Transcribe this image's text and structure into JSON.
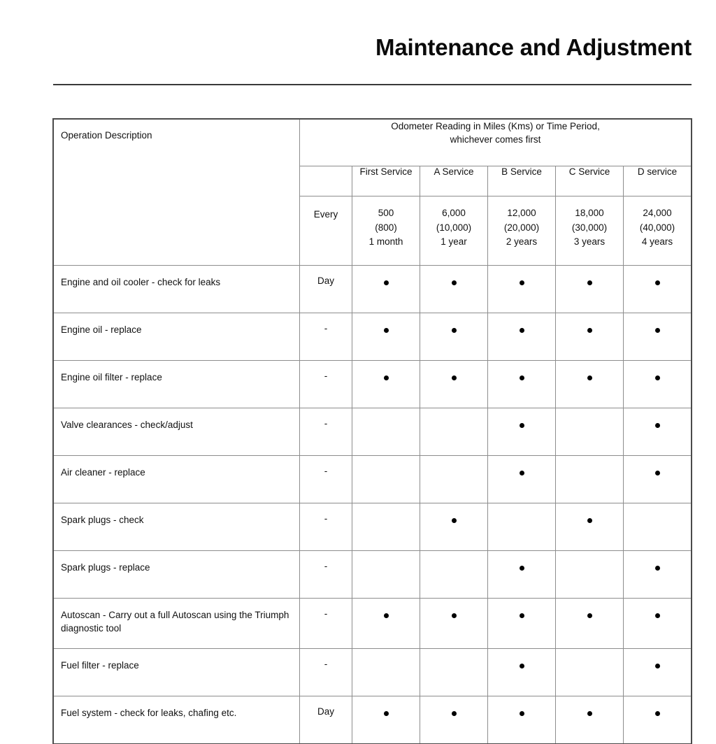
{
  "page": {
    "title": "Maintenance and Adjustment"
  },
  "table": {
    "desc_header": "Operation Description",
    "odometer_header_line1": "Odometer Reading in Miles (Kms) or Time Period,",
    "odometer_header_line2": "whichever comes first",
    "every_label": "Every",
    "service_columns": [
      {
        "name": "First Service",
        "miles": "500",
        "kms": "(800)",
        "time": "1 month"
      },
      {
        "name": "A Service",
        "miles": "6,000",
        "kms": "(10,000)",
        "time": "1 year"
      },
      {
        "name": "B Service",
        "miles": "12,000",
        "kms": "(20,000)",
        "time": "2 years"
      },
      {
        "name": "C Service",
        "miles": "18,000",
        "kms": "(30,000)",
        "time": "3 years"
      },
      {
        "name": "D service",
        "miles": "24,000",
        "kms": "(40,000)",
        "time": "4 years"
      }
    ],
    "rows": [
      {
        "description": "Engine and oil cooler - check for leaks",
        "every": "Day",
        "marks": [
          "●",
          "●",
          "●",
          "●",
          "●"
        ]
      },
      {
        "description": "Engine oil - replace",
        "every": "-",
        "marks": [
          "●",
          "●",
          "●",
          "●",
          "●"
        ]
      },
      {
        "description": "Engine oil filter - replace",
        "every": "-",
        "marks": [
          "●",
          "●",
          "●",
          "●",
          "●"
        ]
      },
      {
        "description": "Valve clearances - check/adjust",
        "every": "-",
        "marks": [
          "",
          "",
          "●",
          "",
          "●"
        ]
      },
      {
        "description": "Air cleaner - replace",
        "every": "-",
        "marks": [
          "",
          "",
          "●",
          "",
          "●"
        ]
      },
      {
        "description": "Spark plugs - check",
        "every": "-",
        "marks": [
          "",
          "●",
          "",
          "●",
          ""
        ]
      },
      {
        "description": "Spark plugs - replace",
        "every": "-",
        "marks": [
          "",
          "",
          "●",
          "",
          "●"
        ]
      },
      {
        "description": "Autoscan - Carry out a full Autoscan using the Triumph diagnostic tool",
        "every": "-",
        "marks": [
          "●",
          "●",
          "●",
          "●",
          "●"
        ],
        "tall": true
      },
      {
        "description": "Fuel filter - replace",
        "every": "-",
        "marks": [
          "",
          "",
          "●",
          "",
          "●"
        ]
      },
      {
        "description": "Fuel system - check for leaks, chafing etc.",
        "every": "Day",
        "marks": [
          "●",
          "●",
          "●",
          "●",
          "●"
        ]
      }
    ]
  }
}
